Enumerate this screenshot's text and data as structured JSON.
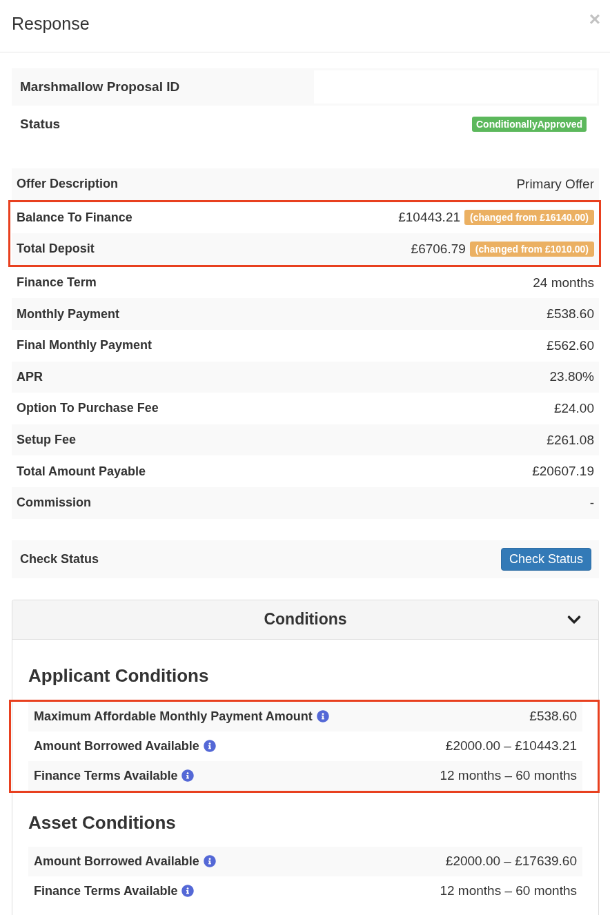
{
  "dialog": {
    "title": "Response",
    "close": "×"
  },
  "proposal": [
    {
      "kind": "blank",
      "label": "Marshmallow Proposal ID"
    },
    {
      "kind": "status",
      "label": "Status",
      "value": "ConditionallyApproved"
    }
  ],
  "offer": [
    {
      "label": "Offer Description",
      "value": "Primary Offer",
      "highlighted": false
    },
    {
      "label": "Balance To Finance",
      "value": "£10443.21",
      "changed_from": "(changed from £16140.00)",
      "highlighted": true
    },
    {
      "label": "Total Deposit",
      "value": "£6706.79",
      "changed_from": "(changed from £1010.00)",
      "highlighted": true
    },
    {
      "label": "Finance Term",
      "value": "24 months",
      "highlighted": false
    },
    {
      "label": "Monthly Payment",
      "value": "£538.60",
      "highlighted": false
    },
    {
      "label": "Final Monthly Payment",
      "value": "£562.60",
      "highlighted": false
    },
    {
      "label": "APR",
      "value": "23.80%",
      "highlighted": false
    },
    {
      "label": "Option To Purchase Fee",
      "value": "£24.00",
      "highlighted": false
    },
    {
      "label": "Setup Fee",
      "value": "£261.08",
      "highlighted": false
    },
    {
      "label": "Total Amount Payable",
      "value": "£20607.19",
      "highlighted": false
    },
    {
      "label": "Commission",
      "value": "-",
      "highlighted": false
    }
  ],
  "check_status": {
    "label": "Check Status",
    "button": "Check Status"
  },
  "conditions": {
    "title": "Conditions",
    "expanded": true,
    "sections": [
      {
        "title": "Applicant Conditions",
        "rows": [
          {
            "label": "Maximum Affordable Monthly Payment Amount",
            "value": "£538.60",
            "highlighted": true
          },
          {
            "label": "Amount Borrowed Available",
            "value": "£2000.00 – £10443.21",
            "highlighted": true
          },
          {
            "label": "Finance Terms Available",
            "value": "12 months – 60 months",
            "highlighted": true
          }
        ]
      },
      {
        "title": "Asset Conditions",
        "rows": [
          {
            "label": "Amount Borrowed Available",
            "value": "£2000.00 – £17639.60",
            "highlighted": false
          },
          {
            "label": "Finance Terms Available",
            "value": "12 months – 60 months",
            "highlighted": false
          }
        ]
      }
    ]
  }
}
